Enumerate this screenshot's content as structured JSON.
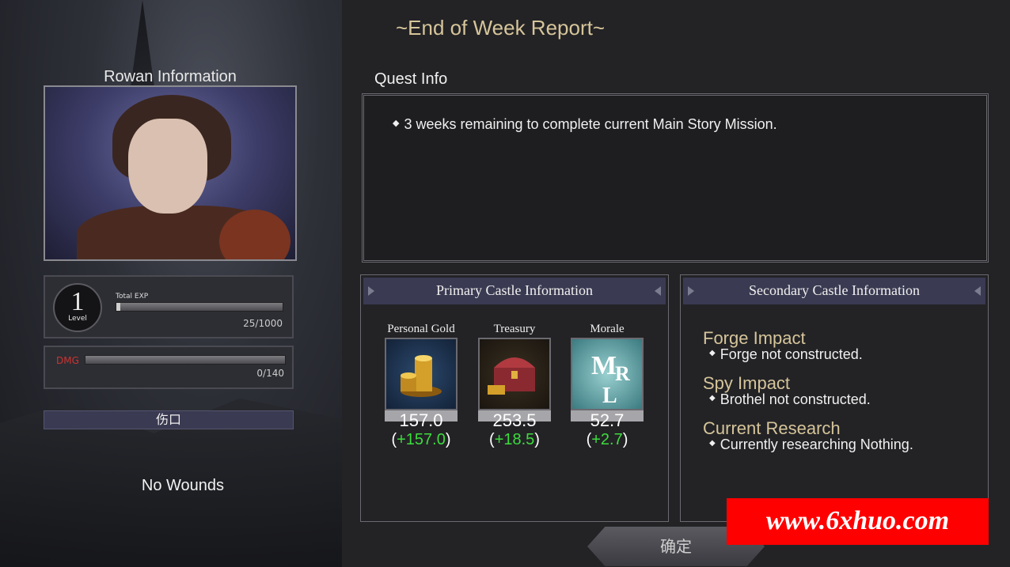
{
  "character": {
    "panel_title": "Rowan Information",
    "level_value": "1",
    "level_label": "Level",
    "exp_label": "Total EXP",
    "exp_value": "25/1000",
    "exp_fraction": 0.025,
    "dmg_label": "DMG",
    "dmg_value": "0/140",
    "dmg_fraction": 0,
    "wounds_header": "伤口",
    "wounds_status": "No Wounds"
  },
  "report": {
    "title": "~End of Week Report~",
    "quest_label": "Quest Info",
    "quest_items": [
      "3 weeks remaining to complete current Main Story Mission."
    ]
  },
  "primary": {
    "header": "Primary Castle Information",
    "resources": [
      {
        "name": "Personal Gold",
        "value": "157.0",
        "delta": "+157.0",
        "icon": "gold-coins-icon"
      },
      {
        "name": "Treasury",
        "value": "253.5",
        "delta": "+18.5",
        "icon": "treasure-chest-icon"
      },
      {
        "name": "Morale",
        "value": "52.7",
        "delta": "+2.7",
        "icon": "morale-banner-icon"
      }
    ]
  },
  "secondary": {
    "header": "Secondary Castle Information",
    "sections": [
      {
        "title": "Forge Impact",
        "line": "Forge not constructed."
      },
      {
        "title": "Spy Impact",
        "line": "Brothel not constructed."
      },
      {
        "title": "Current Research",
        "line": "Currently researching Nothing."
      }
    ]
  },
  "confirm_label": "确定",
  "watermark": "www.6xhuo.com",
  "colors": {
    "accent_gold": "#d6c59a",
    "positive": "#3ddc3d",
    "header_bg": "#3a3a52"
  }
}
